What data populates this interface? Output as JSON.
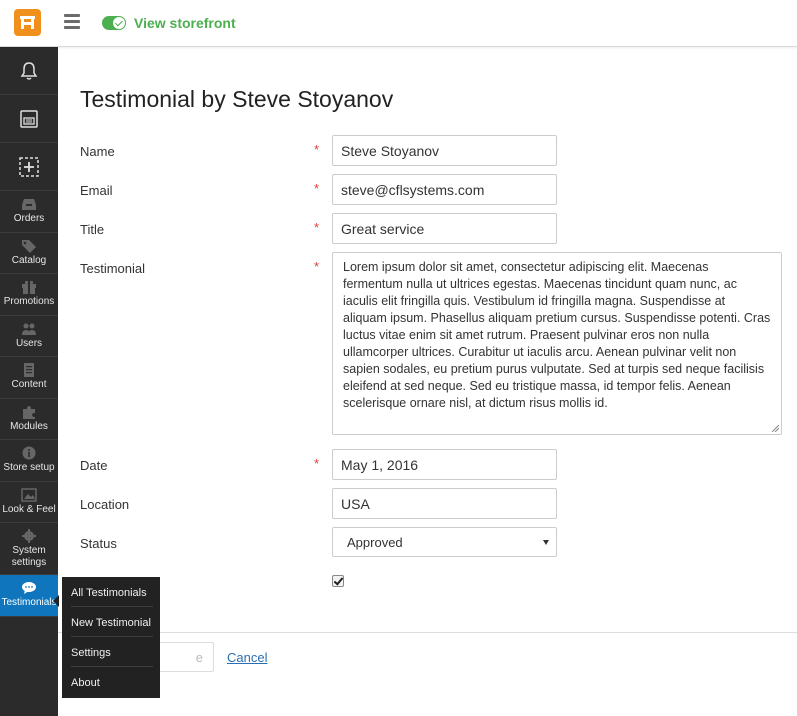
{
  "topbar": {
    "logo_icon": "shop-logo-icon",
    "menu_icon": "hamburger-icon",
    "storefront_label": "View storefront",
    "accent_color": "#4caf50"
  },
  "sidebar": {
    "items": [
      {
        "name": "notifications",
        "icon": "bell-icon",
        "label": ""
      },
      {
        "name": "store",
        "icon": "storefront-icon",
        "label": ""
      },
      {
        "name": "add",
        "icon": "add-icon",
        "label": ""
      },
      {
        "name": "orders",
        "icon": "inbox-icon",
        "label": "Orders"
      },
      {
        "name": "catalog",
        "icon": "tag-icon",
        "label": "Catalog"
      },
      {
        "name": "promotions",
        "icon": "gift-icon",
        "label": "Promotions"
      },
      {
        "name": "users",
        "icon": "users-icon",
        "label": "Users"
      },
      {
        "name": "content",
        "icon": "document-icon",
        "label": "Content"
      },
      {
        "name": "modules",
        "icon": "puzzle-icon",
        "label": "Modules"
      },
      {
        "name": "store-setup",
        "icon": "info-icon",
        "label": "Store setup"
      },
      {
        "name": "look-feel",
        "icon": "image-icon",
        "label": "Look & Feel"
      },
      {
        "name": "system-settings",
        "icon": "gear-icon",
        "label": "System settings"
      },
      {
        "name": "testimonials",
        "icon": "chat-icon",
        "label": "Testimonials"
      }
    ],
    "active_color": "#0f75bc"
  },
  "flyout": {
    "items": [
      "All Testimonials",
      "New Testimonial",
      "Settings",
      "About"
    ]
  },
  "form": {
    "title": "Testimonial by Steve Stoyanov",
    "required_mark": "*",
    "name_label": "Name",
    "name_value": "Steve Stoyanov",
    "email_label": "Email",
    "email_value": "steve@cflsystems.com",
    "title_label": "Title",
    "title_value": "Great service",
    "testimonial_label": "Testimonial",
    "testimonial_value": "Lorem ipsum dolor sit amet, consectetur adipiscing elit. Maecenas fermentum nulla ut ultrices egestas. Maecenas tincidunt quam nunc, ac iaculis elit fringilla quis. Vestibulum id fringilla magna. Suspendisse at aliquam ipsum. Phasellus aliquam pretium cursus. Suspendisse potenti. Cras luctus vitae enim sit amet rutrum. Praesent pulvinar eros non nulla ullamcorper ultrices. Curabitur ut iaculis arcu. Aenean pulvinar velit non sapien sodales, eu pretium purus vulputate. Sed at turpis sed neque facilisis eleifend at sed neque. Sed eu tristique massa, id tempor felis. Aenean scelerisque ornare nisl, at dictum risus mollis id.",
    "date_label": "Date",
    "date_value": "May  1, 2016",
    "location_label": "Location",
    "location_value": "USA",
    "status_label": "Status",
    "status_value": "Approved",
    "enabled_checked": true
  },
  "footer": {
    "save_label": "e",
    "cancel_label": "Cancel"
  }
}
